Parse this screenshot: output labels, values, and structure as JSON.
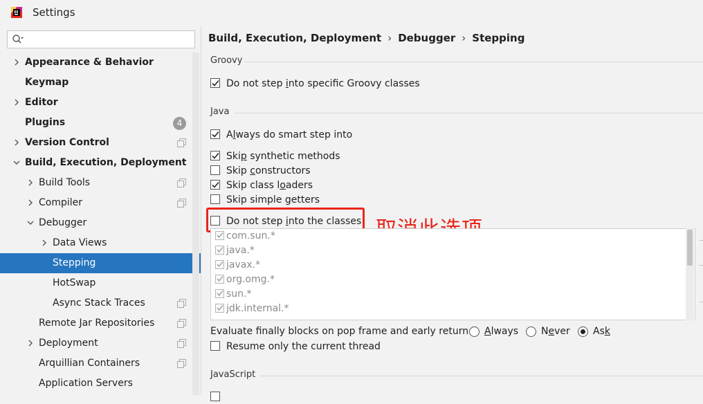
{
  "window": {
    "title": "Settings"
  },
  "search": {
    "placeholder": ""
  },
  "sidebar": {
    "items": [
      {
        "label": "Appearance & Behavior",
        "chevron": "right",
        "bold": true
      },
      {
        "label": "Keymap",
        "bold": true
      },
      {
        "label": "Editor",
        "chevron": "right",
        "bold": true
      },
      {
        "label": "Plugins",
        "bold": true,
        "badge": "4"
      },
      {
        "label": "Version Control",
        "chevron": "right",
        "bold": true,
        "icon": "copy-icon"
      },
      {
        "label": "Build, Execution, Deployment",
        "chevron": "down",
        "bold": true
      },
      {
        "label": "Build Tools",
        "chevron": "right",
        "icon": "copy-icon"
      },
      {
        "label": "Compiler",
        "chevron": "right",
        "icon": "copy-icon"
      },
      {
        "label": "Debugger",
        "chevron": "down"
      },
      {
        "label": "Data Views",
        "chevron": "right"
      },
      {
        "label": "Stepping",
        "selected": true
      },
      {
        "label": "HotSwap"
      },
      {
        "label": "Async Stack Traces",
        "icon": "copy-icon"
      },
      {
        "label": "Remote Jar Repositories",
        "icon": "copy-icon"
      },
      {
        "label": "Deployment",
        "chevron": "right",
        "icon": "copy-icon"
      },
      {
        "label": "Arquillian Containers",
        "icon": "copy-icon"
      },
      {
        "label": "Application Servers"
      }
    ]
  },
  "breadcrumb": {
    "part1": "Build, Execution, Deployment",
    "part2": "Debugger",
    "part3": "Stepping",
    "separator": "›"
  },
  "groovy": {
    "title": "Groovy",
    "option": {
      "label": "Do not step into specific Groovy classes",
      "checked": true
    }
  },
  "java": {
    "title": "Java",
    "options": [
      {
        "label": "Always do smart step into",
        "checked": true
      },
      {
        "label": "Skip synthetic methods",
        "checked": true
      },
      {
        "label": "Skip constructors",
        "checked": false
      },
      {
        "label": "Skip class loaders",
        "checked": true
      },
      {
        "label": "Skip simple getters",
        "checked": false
      },
      {
        "label": "Do not step into the classes",
        "checked": false
      }
    ],
    "classes": [
      "com.sun.*",
      "java.*",
      "javax.*",
      "org.omg.*",
      "sun.*",
      "jdk.internal.*"
    ],
    "evaluate": {
      "label": "Evaluate finally blocks on pop frame and early return:",
      "options": [
        "Always",
        "Never",
        "Ask"
      ],
      "selected": "Ask"
    },
    "resume_option": {
      "label": "Resume only the current thread",
      "checked": false
    }
  },
  "javascript": {
    "title": "JavaScript"
  },
  "annotation": {
    "text": "取消此选项",
    "color": "#e8261a"
  },
  "colors": {
    "selection": "#2675bf",
    "accent_red": "#e8261a"
  }
}
